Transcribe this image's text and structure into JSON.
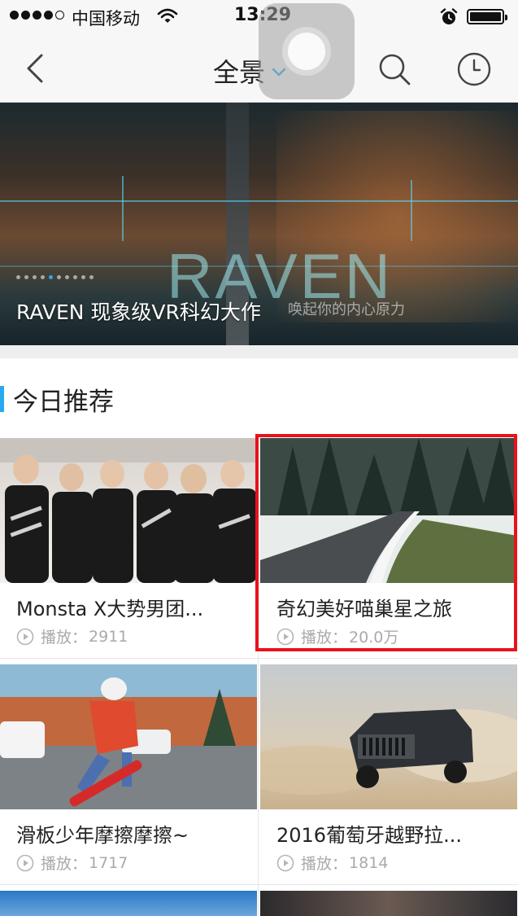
{
  "status_bar": {
    "carrier": "中国移动",
    "time": "13:29"
  },
  "nav": {
    "title": "全景",
    "icons": [
      "back-arrow-icon",
      "chevron-down-icon",
      "search-icon",
      "history-clock-icon"
    ]
  },
  "banner": {
    "caption": "RAVEN 现象级VR科幻大作",
    "art_title": "RAVEN",
    "art_subtitle": "唤起你的内心原力",
    "page_count": 10,
    "active_page": 4
  },
  "section": {
    "title": "今日推荐"
  },
  "videos": [
    {
      "title": "Monsta X大势男团...",
      "play_label": "播放：",
      "plays": "2911"
    },
    {
      "title": "奇幻美好喵巢星之旅",
      "play_label": "播放：",
      "plays": "20.0万"
    },
    {
      "title": "滑板少年摩擦摩擦~",
      "play_label": "播放：",
      "plays": "1717"
    },
    {
      "title": "2016葡萄牙越野拉...",
      "play_label": "播放：",
      "plays": "1814"
    }
  ],
  "colors": {
    "accent": "#2aa8f0",
    "highlight": "#e8121b"
  }
}
